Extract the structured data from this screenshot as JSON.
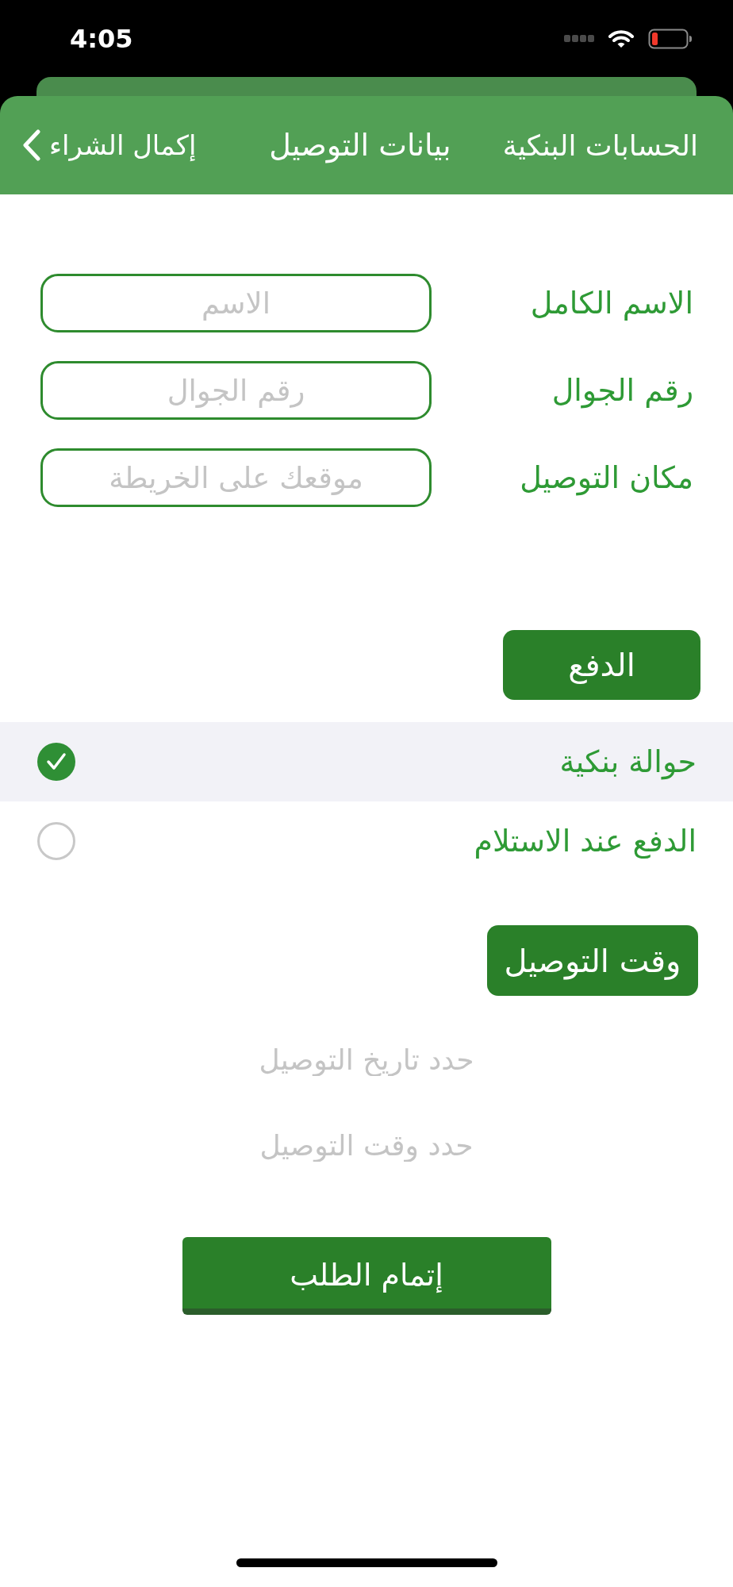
{
  "status_bar": {
    "time": "4:05"
  },
  "nav_bar": {
    "right_button": "الحسابات البنكية",
    "title": "بيانات التوصيل",
    "back_button": "إكمال الشراء"
  },
  "form": {
    "fields": [
      {
        "label": "الاسم الكامل",
        "placeholder": "الاسم"
      },
      {
        "label": "رقم الجوال",
        "placeholder": "رقم الجوال"
      },
      {
        "label": "مكان التوصيل",
        "placeholder": "موقعك على الخريطة"
      }
    ]
  },
  "payment": {
    "heading": "الدفع",
    "options": [
      {
        "label": "حوالة بنكية",
        "selected": true
      },
      {
        "label": "الدفع عند الاستلام",
        "selected": false
      }
    ]
  },
  "delivery_time": {
    "heading": "وقت التوصيل",
    "pickers": [
      {
        "placeholder": "حدد تاريخ التوصيل"
      },
      {
        "placeholder": "حدد وقت التوصيل"
      }
    ]
  },
  "submit_button": "إتمام الطلب"
}
